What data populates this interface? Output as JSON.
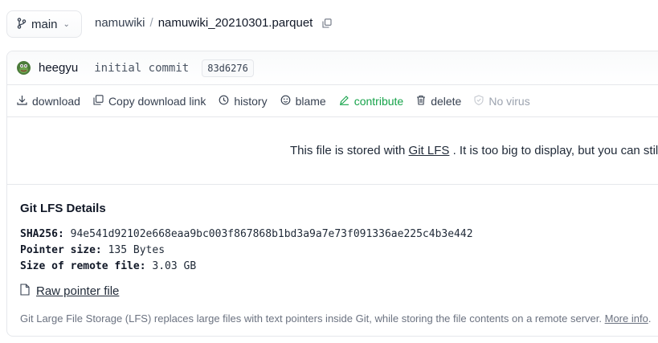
{
  "header": {
    "branch": "main",
    "repo": "namuwiki",
    "separator": "/",
    "file": "namuwiki_20210301.parquet"
  },
  "commit": {
    "author": "heegyu",
    "message": "initial commit",
    "hash": "83d6276"
  },
  "actions": {
    "download": "download",
    "copy_link": "Copy download link",
    "history": "history",
    "blame": "blame",
    "contribute": "contribute",
    "delete": "delete",
    "no_virus": "No virus"
  },
  "notice": {
    "prefix": "This file is stored with ",
    "link": "Git LFS",
    "suffix": " . It is too big to display, but you can still"
  },
  "lfs": {
    "title": "Git LFS Details",
    "sha_label": "SHA256:",
    "sha_value": "94e541d92102e668eaa9bc003f867868b1bd3a9a7e73f091336ae225c4b3e442",
    "pointer_label": "Pointer size:",
    "pointer_value": "135 Bytes",
    "remote_label": "Size of remote file:",
    "remote_value": "3.03 GB",
    "raw_link": "Raw pointer file",
    "footnote": "Git Large File Storage (LFS) replaces large files with text pointers inside Git, while storing the file contents on a remote server. ",
    "more_info": "More info",
    "period": "."
  },
  "colors": {
    "contribute": "#16a34a",
    "border": "#e5e7eb",
    "muted": "#6b7280"
  },
  "icons": [
    "branch-icon",
    "chevron-down-icon",
    "copy-icon",
    "avatar",
    "download-icon",
    "copy-link-icon",
    "history-icon",
    "blame-icon",
    "pencil-icon",
    "trash-icon",
    "shield-icon",
    "file-icon"
  ]
}
